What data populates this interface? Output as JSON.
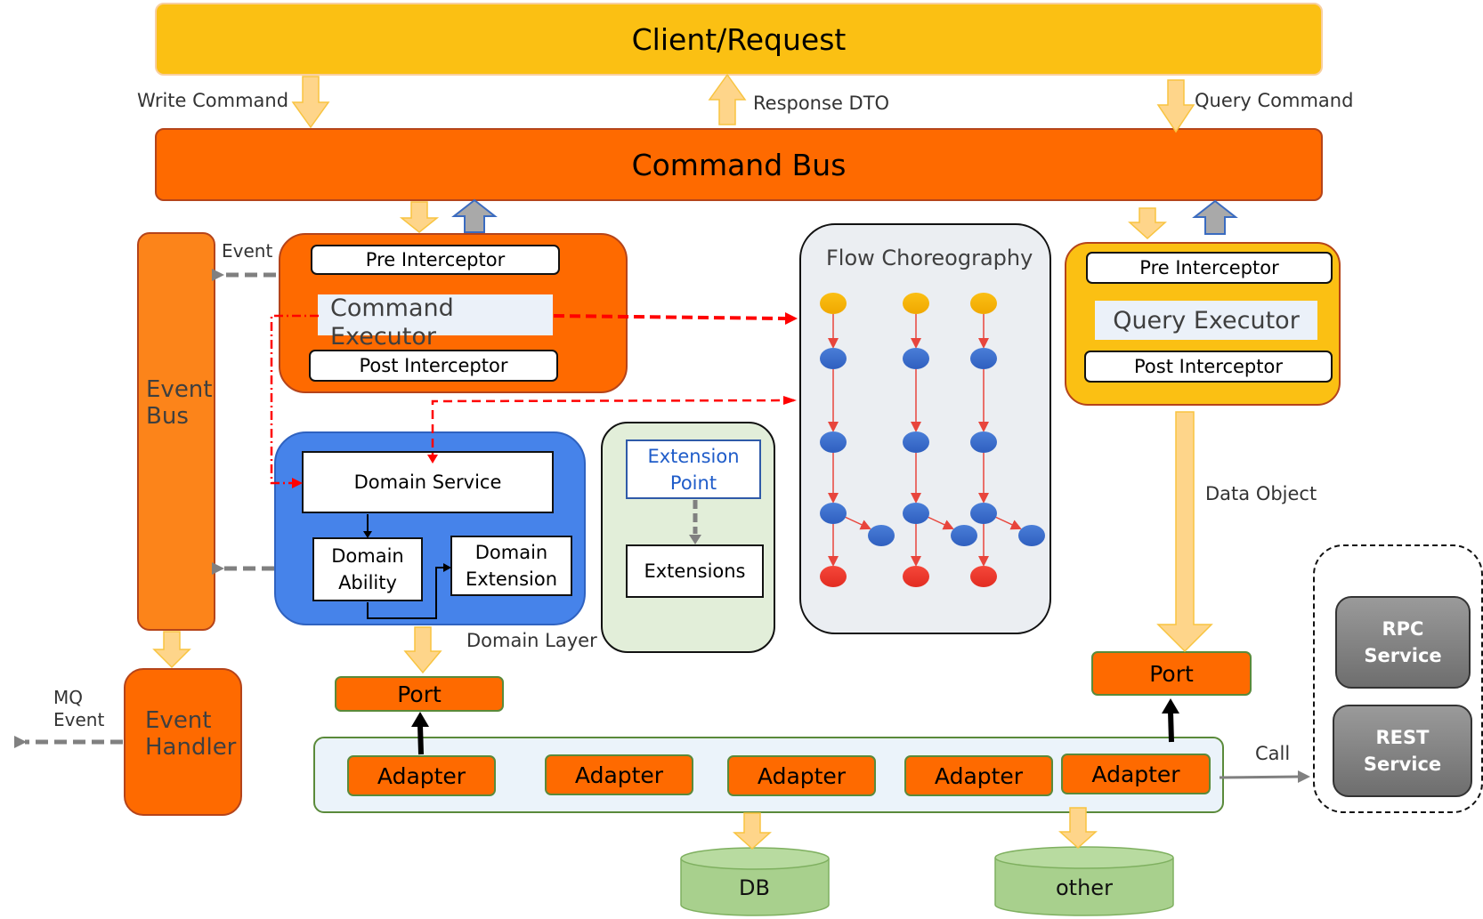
{
  "diagram": {
    "client": "Client/Request",
    "command_bus": "Command Bus",
    "flows": {
      "write_command": "Write Command",
      "response_dto": "Response DTO",
      "query_command": "Query Command",
      "event": "Event",
      "mq_event": [
        "MQ",
        "Event"
      ],
      "data_object": "Data Object",
      "call": "Call",
      "domain_layer": "Domain Layer"
    },
    "event_bus": [
      "Event",
      "Bus"
    ],
    "event_handler": [
      "Event",
      "Handler"
    ],
    "command_executor": {
      "pre": "Pre Interceptor",
      "title": [
        "Command",
        "Executor"
      ],
      "post": "Post Interceptor"
    },
    "domain": {
      "service": "Domain Service",
      "ability": [
        "Domain",
        "Ability"
      ],
      "extension": [
        "Domain",
        "Extension"
      ]
    },
    "extension_panel": {
      "point": [
        "Extension",
        "Point"
      ],
      "extensions": "Extensions"
    },
    "flow_choreography": {
      "title": "Flow Choreography",
      "columns": 3,
      "node_colors": {
        "start": "#fbbf14",
        "step": "#3b6fd0",
        "end": "#ee3a2d",
        "edge": "#e8453c"
      }
    },
    "query_executor": {
      "pre": "Pre Interceptor",
      "title": "Query Executor",
      "post": "Post Interceptor"
    },
    "ports": [
      "Port",
      "Port"
    ],
    "adapters": [
      "Adapter",
      "Adapter",
      "Adapter",
      "Adapter",
      "Adapter"
    ],
    "stores": [
      "DB",
      "other"
    ],
    "external_services": [
      [
        "RPC",
        "Service"
      ],
      [
        "REST",
        "Service"
      ]
    ],
    "colors": {
      "client": "#fbc013",
      "command_bus": "#fe6a00",
      "event_bus": "#fc841a",
      "domain_layer": "#4683ea",
      "extension_panel": "#e2eed9",
      "flow_panel": "#ebeef2",
      "store": "#a8d08d",
      "flow_arrow": "#fed58a",
      "dashed_red": "#ff0000"
    }
  }
}
